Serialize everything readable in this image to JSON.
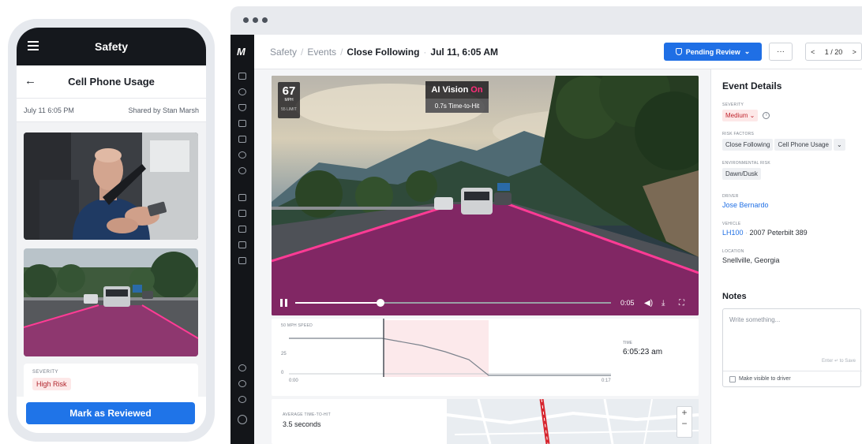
{
  "phone": {
    "app_title": "Safety",
    "screen_title": "Cell Phone Usage",
    "date": "July 11  6:05 PM",
    "shared_by": "Shared by Stan Marsh",
    "severity_label": "SEVERITY",
    "severity_value": "High Risk",
    "review_button": "Mark as Reviewed",
    "icons": [
      "menu-icon",
      "back-arrow-icon"
    ]
  },
  "app": {
    "logo": "M",
    "breadcrumb": {
      "root": "Safety",
      "section": "Events",
      "event": "Close Following",
      "datetime": "Jul 11, 6:05 AM"
    },
    "pending_label": "Pending Review",
    "more_label": "···",
    "pager": {
      "prev": "<",
      "page": "1 / 20",
      "next": ">"
    },
    "colors": {
      "accent": "#1f6fe5",
      "risk_red": "#c0262f",
      "ai_on": "#ff2e7a",
      "lane_overlay": "#c2187a"
    }
  },
  "video": {
    "speed": "67",
    "speed_unit": "MPH",
    "speed_limit": "55 LIMIT",
    "ai_label": "AI Vision",
    "ai_state": "On",
    "ai_sub": "0.7s Time-to-Hit",
    "time": "0:05",
    "progress": 0.27
  },
  "graph": {
    "label": "50 MPH SPEED",
    "ticks": [
      "25",
      "0"
    ],
    "x_start": "0:00",
    "x_end": "0:17",
    "time_label": "TIME",
    "time_value": "6:05:23 am"
  },
  "stats": {
    "label": "AVERAGE TIME-TO-HIT",
    "value": "3.5 seconds"
  },
  "details": {
    "title": "Event Details",
    "severity_label": "SEVERITY",
    "severity_value": "Medium",
    "risk_label": "RISK FACTORS",
    "risk1": "Close Following",
    "risk2": "Cell Phone Usage",
    "env_label": "ENVIRONMENTAL RISK",
    "env_value": "Dawn/Dusk",
    "driver_label": "DRIVER",
    "driver_value": "Jose Bernardo",
    "vehicle_label": "VEHICLE",
    "vehicle_id": "LH100",
    "vehicle_model": "2007 Peterbilt 389",
    "location_label": "LOCATION",
    "location_value": "Snellville, Georgia",
    "notes_title": "Notes",
    "notes_placeholder": "Write something...",
    "notes_hint": "Enter ↵ to Save",
    "visible_label": "Make visible to driver"
  }
}
